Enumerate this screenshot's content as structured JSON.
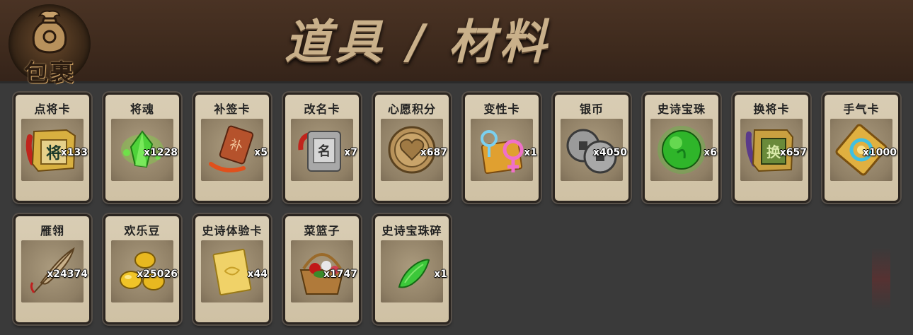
{
  "header": {
    "bag_label": "包裹",
    "title": "道具 / 材料"
  },
  "items": [
    {
      "name": "点将卡",
      "count": "x133",
      "icon": "commander-card-icon"
    },
    {
      "name": "将魂",
      "count": "x1228",
      "icon": "green-crystal-icon"
    },
    {
      "name": "补签卡",
      "count": "x5",
      "icon": "signin-card-icon"
    },
    {
      "name": "改名卡",
      "count": "x7",
      "icon": "rename-card-icon"
    },
    {
      "name": "心愿积分",
      "count": "x687",
      "icon": "heart-coin-icon"
    },
    {
      "name": "变性卡",
      "count": "x1",
      "icon": "gender-card-icon"
    },
    {
      "name": "银币",
      "count": "x4050",
      "icon": "silver-coin-icon"
    },
    {
      "name": "史诗宝珠",
      "count": "x6",
      "icon": "green-orb-icon"
    },
    {
      "name": "换将卡",
      "count": "x657",
      "icon": "swap-card-icon"
    },
    {
      "name": "手气卡",
      "count": "x1000",
      "icon": "luck-card-icon"
    },
    {
      "name": "雁翎",
      "count": "x24374",
      "icon": "feather-icon"
    },
    {
      "name": "欢乐豆",
      "count": "x25026",
      "icon": "gold-beans-icon"
    },
    {
      "name": "史诗体验卡",
      "count": "x44",
      "icon": "gold-card-icon"
    },
    {
      "name": "菜篮子",
      "count": "x1747",
      "icon": "flower-basket-icon"
    },
    {
      "name": "史诗宝珠碎",
      "count": "x1",
      "icon": "jade-shard-icon"
    }
  ]
}
